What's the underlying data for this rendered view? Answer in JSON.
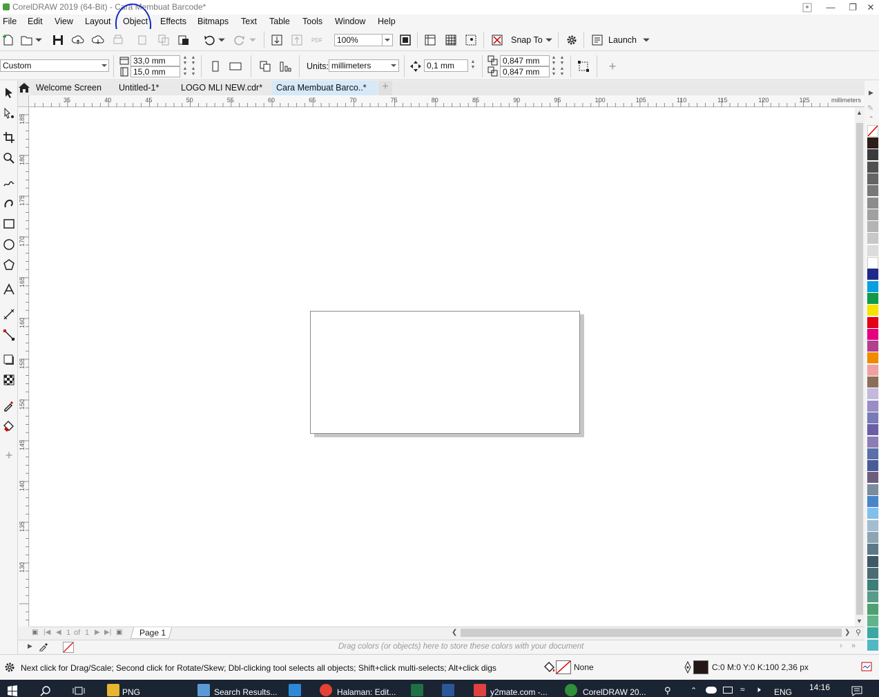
{
  "window": {
    "title": "CorelDRAW 2019 (64-Bit) - Cara Membuat Barcode*",
    "controls": [
      "minimize",
      "restore",
      "close"
    ]
  },
  "menu": [
    "File",
    "Edit",
    "View",
    "Layout",
    "Object",
    "Effects",
    "Bitmaps",
    "Text",
    "Table",
    "Tools",
    "Window",
    "Help"
  ],
  "toolbar": {
    "zoom": "100%",
    "snap_to": "Snap To",
    "launch": "Launch"
  },
  "propertybar": {
    "page_preset": "Custom",
    "width": "33,0 mm",
    "height": "15,0 mm",
    "units_label": "Units:",
    "units": "millimeters",
    "nudge": "0,1 mm",
    "dup_x": "0,847 mm",
    "dup_y": "0,847 mm"
  },
  "tabs": [
    {
      "label": "Welcome Screen",
      "active": false
    },
    {
      "label": "Untitled-1*",
      "active": false
    },
    {
      "label": "LOGO MLI NEW.cdr*",
      "active": false
    },
    {
      "label": "Cara Membuat Barco..*",
      "active": true
    }
  ],
  "ruler": {
    "h_labels": [
      "35",
      "40",
      "45",
      "50",
      "55",
      "60",
      "65",
      "70",
      "75",
      "80",
      "85",
      "90",
      "95",
      "100",
      "105",
      "110",
      "115",
      "120",
      "125"
    ],
    "h_unit": "millimeters",
    "v_labels": [
      "185",
      "180",
      "175",
      "170",
      "165",
      "160",
      "155",
      "150",
      "145",
      "140",
      "135",
      "130"
    ]
  },
  "page_nav": {
    "current": "1",
    "of_label": "of",
    "total": "1",
    "page_tab": "Page 1"
  },
  "doc_palette_hint": "Drag colors (or objects) here to store these colors with your document",
  "status": {
    "message": "Next click for Drag/Scale; Second click for Rotate/Skew; Dbl-clicking tool selects all objects; Shift+click multi-selects; Alt+click digs",
    "fill": "None",
    "outline": "C:0 M:0 Y:0 K:100  2,36 px"
  },
  "palette_colors": [
    "#2b1d17",
    "#3b3b3b",
    "#505050",
    "#646464",
    "#787878",
    "#8c8c8c",
    "#a0a0a0",
    "#b4b4b4",
    "#c8c8c8",
    "#dcdcdc",
    "#ffffff",
    "#1d2a8c",
    "#0a9fe0",
    "#109a4a",
    "#f4e400",
    "#e40016",
    "#e4007f",
    "#b0418e",
    "#f08a00",
    "#f0a0a0",
    "#8b6e5a",
    "#c4b8dc",
    "#9a8cc4",
    "#7a7ab8",
    "#6a5ea4",
    "#8c7eb4",
    "#5a6ea8",
    "#4a5a98",
    "#6e5e7e",
    "#7a8ca0",
    "#4a84c8",
    "#80c0ec",
    "#a4bcd0",
    "#8ca4b4",
    "#5a7888",
    "#3e5868",
    "#4a6c74",
    "#3e7e78",
    "#5a9a8a",
    "#4ea070",
    "#60b48a",
    "#3aa8a0",
    "#50b8c4"
  ],
  "taskbar": {
    "items": [
      "PNG",
      "Search Results...",
      "Halaman: Edit...",
      "y2mate.com -...",
      "CorelDRAW 20..."
    ],
    "lang": "ENG",
    "time": "14:16"
  }
}
